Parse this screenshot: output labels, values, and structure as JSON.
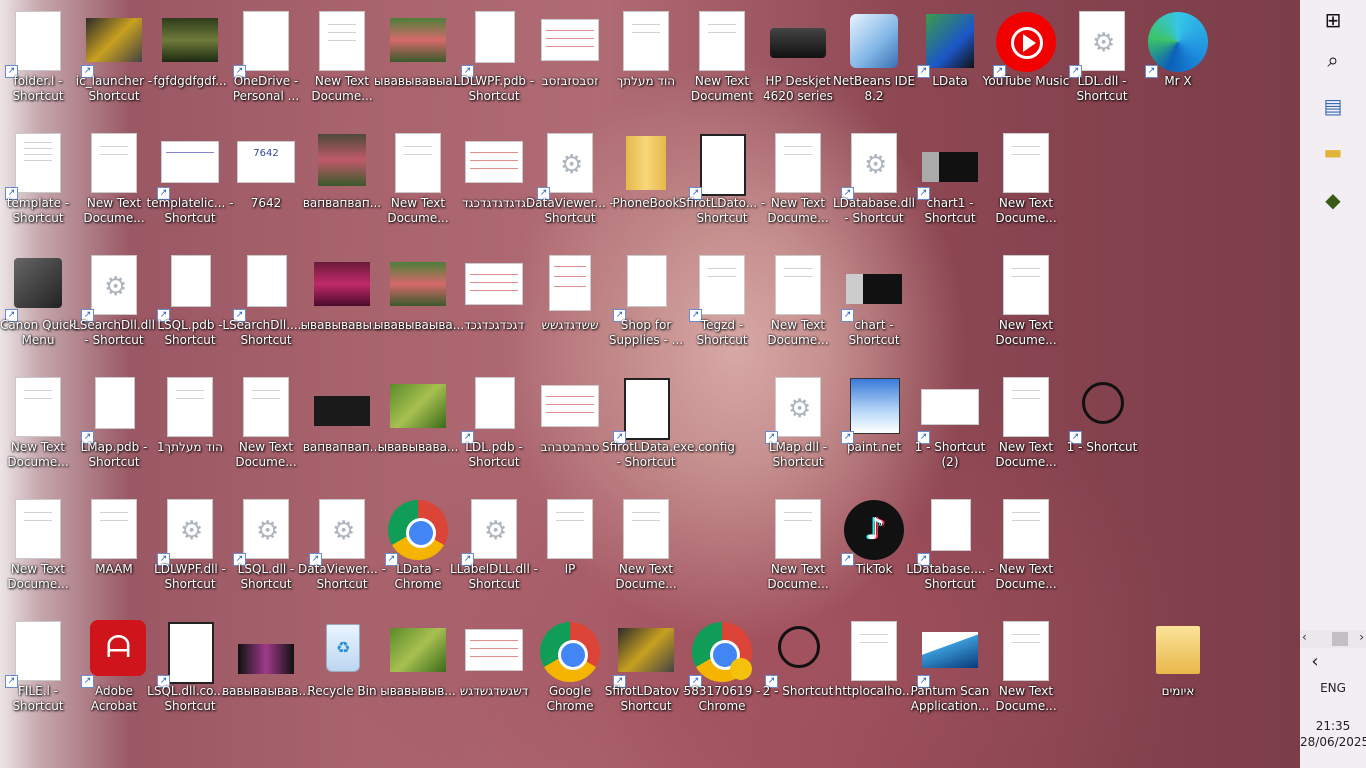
{
  "taskbar": {
    "language": "ENG",
    "time": "21:35",
    "date": "28/06/2025"
  },
  "icons": [
    [
      "folder.l - Shortcut",
      "ic_launcher - Shortcut",
      "fgfdgdfgdf...",
      "OneDrive - Personal ...",
      "New Text Docume...",
      "ывавывавыа...",
      "LDLWPF.pdb - Shortcut",
      "זסבסזבזסב",
      "הוד מעלתך",
      "New Text Document",
      "HP Deskjet 4620 series",
      "NetBeans IDE 8.2",
      "LData",
      "YouTube Music",
      "LDL.dll - Shortcut",
      "Mr X"
    ],
    [
      "template - Shortcut",
      "New Text Docume...",
      "templatelic... - Shortcut",
      "7642",
      "вапвапвап...",
      "New Text Docume...",
      "גדגדגדגדכגד",
      "DataViewer... - Shortcut",
      "PhoneBook",
      "SfirotLDato... - Shortcut",
      "New Text Docume...",
      "LDatabase.dll - Shortcut",
      "chart1 - Shortcut",
      "New Text Docume..."
    ],
    [
      "Canon Quick Menu",
      "LSearchDll.dll - Shortcut",
      "LSQL.pdb - Shortcut",
      "LSearchDll.... - Shortcut",
      "ывавывавы...",
      "ывавываыва...",
      "דגכדגכדגכד",
      "ששדגדגשש",
      "Shop for Supplies - ...",
      "Tegzd - Shortcut",
      "New Text Docume...",
      "chart - Shortcut",
      "New Text Docume..."
    ],
    [
      "New Text Docume...",
      "LMap.pdb - Shortcut",
      "הוד מעלתך1",
      "New Text Docume...",
      "вапвапвап...",
      "ывавывава...",
      "LDL.pdb - Shortcut",
      "סבהבסבהב",
      "SfirotLData.exe.config - Shortcut",
      "LMap.dll - Shortcut",
      "paint.net",
      "1 - Shortcut (2)",
      "New Text Docume...",
      "1 - Shortcut"
    ],
    [
      "New Text Docume...",
      "MAAM",
      "LDLWPF.dll - Shortcut",
      "LSQL.dll - Shortcut",
      "DataViewer... - Shortcut",
      "LData - Chrome",
      "LLabelDLL.dll - Shortcut",
      "IP",
      "New Text Docume...",
      "New Text Docume...",
      "TikTok",
      "LDatabase.... - Shortcut",
      "New Text Docume..."
    ],
    [
      "FILE.l - Shortcut",
      "Adobe Acrobat",
      "LSQL.dll.co... - Shortcut",
      "вавываывав...",
      "Recycle Bin",
      "ывавывыв...",
      "דשגשדגשדגש",
      "Google Chrome",
      "SfirotLDatov - Shortcut",
      "583170619 - Chrome",
      "2 - Shortcut",
      "httplocalho...",
      "Pantum Scan Application...",
      "New Text Docume...",
      "איומים"
    ]
  ],
  "icon_names": {
    "start": "windows-logo-icon",
    "search": "search-icon",
    "app1": "pinned-app-icon",
    "files": "file-explorer-icon",
    "app2": "pinned-app-2-icon",
    "chevron": "chevron-left-icon"
  }
}
